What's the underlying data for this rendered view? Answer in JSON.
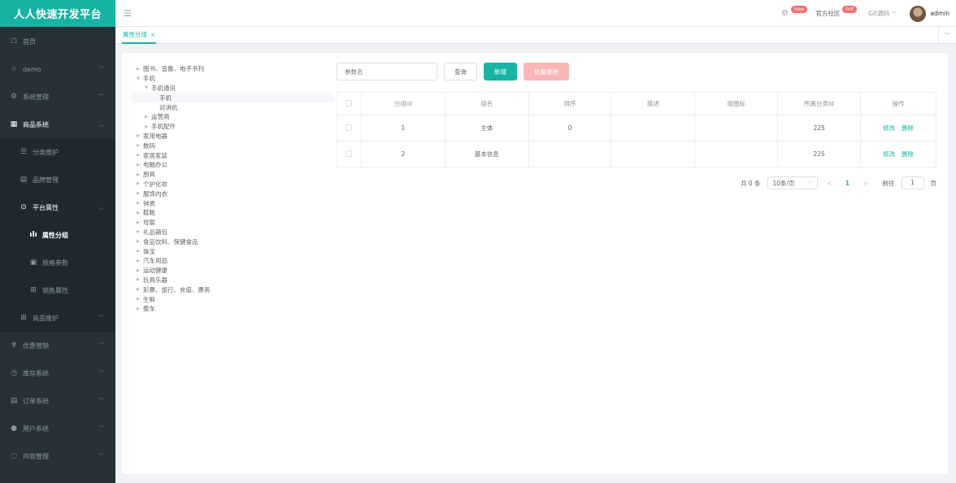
{
  "brand": "人人快速开发平台",
  "topbar": {
    "new_badge": "new",
    "community_label": "官方社区",
    "hot_badge": "hot",
    "git_label": "Git源码",
    "user_name": "admin"
  },
  "sidebar": {
    "items": [
      {
        "label": "首页",
        "icon": "☖"
      },
      {
        "label": "demo",
        "icon": "☆"
      },
      {
        "label": "系统管理",
        "icon": "⚙"
      },
      {
        "label": "商品系统",
        "icon": "▦"
      },
      {
        "label": "分类维护",
        "icon": "☰"
      },
      {
        "label": "品牌管理",
        "icon": "▤"
      },
      {
        "label": "平台属性",
        "icon": "⊙"
      },
      {
        "label": "属性分组",
        "icon": "ılı"
      },
      {
        "label": "规格参数",
        "icon": "▣"
      },
      {
        "label": "销售属性",
        "icon": "⊞"
      },
      {
        "label": "商品维护",
        "icon": "⊞"
      },
      {
        "label": "优惠营销",
        "icon": "♆"
      },
      {
        "label": "库存系统",
        "icon": "◷"
      },
      {
        "label": "订单系统",
        "icon": "▤"
      },
      {
        "label": "用户系统",
        "icon": "●"
      },
      {
        "label": "内容管理",
        "icon": "◌"
      }
    ]
  },
  "tabs": [
    {
      "label": "属性分组",
      "close": "×"
    }
  ],
  "tree": [
    {
      "label": "图书、音像、电子书刊",
      "caret": "▶"
    },
    {
      "label": "手机",
      "caret": "▼"
    },
    {
      "label": "手机通讯",
      "caret": "▼"
    },
    {
      "label": "手机",
      "caret": ""
    },
    {
      "label": "对讲机",
      "caret": ""
    },
    {
      "label": "运营商",
      "caret": "▶"
    },
    {
      "label": "手机配件",
      "caret": "▶"
    },
    {
      "label": "家用电器",
      "caret": "▶"
    },
    {
      "label": "数码",
      "caret": "▶"
    },
    {
      "label": "家居家装",
      "caret": "▶"
    },
    {
      "label": "电脑办公",
      "caret": "▶"
    },
    {
      "label": "厨具",
      "caret": "▶"
    },
    {
      "label": "个护化妆",
      "caret": "▶"
    },
    {
      "label": "服饰内衣",
      "caret": "▶"
    },
    {
      "label": "钟表",
      "caret": "▶"
    },
    {
      "label": "鞋靴",
      "caret": "▶"
    },
    {
      "label": "母婴",
      "caret": "▶"
    },
    {
      "label": "礼品箱包",
      "caret": "▶"
    },
    {
      "label": "食品饮料、保健食品",
      "caret": "▶"
    },
    {
      "label": "珠宝",
      "caret": "▶"
    },
    {
      "label": "汽车用品",
      "caret": "▶"
    },
    {
      "label": "运动健康",
      "caret": "▶"
    },
    {
      "label": "玩具乐器",
      "caret": "▶"
    },
    {
      "label": "彩票、旅行、充值、票务",
      "caret": "▶"
    },
    {
      "label": "生鲜",
      "caret": "▶"
    },
    {
      "label": "整车",
      "caret": "▶"
    }
  ],
  "toolbar": {
    "search_placeholder": "参数名",
    "query_label": "查询",
    "add_label": "新增",
    "batch_delete_label": "批量删除"
  },
  "table": {
    "headers": [
      "分组id",
      "组名",
      "排序",
      "描述",
      "组图标",
      "所属分类id",
      "操作"
    ],
    "rows": [
      {
        "id": "1",
        "name": "主体",
        "sort": "0",
        "desc": "",
        "icon": "",
        "catelog_id": "225",
        "edit": "修改",
        "delete": "删除"
      },
      {
        "id": "2",
        "name": "基本信息",
        "sort": "",
        "desc": "",
        "icon": "",
        "catelog_id": "225",
        "edit": "修改",
        "delete": "删除"
      }
    ]
  },
  "pagination": {
    "total_text": "共 0 条",
    "page_size": "10条/页",
    "prev": "<",
    "current": "1",
    "next": ">",
    "goto_label": "前往",
    "goto_value": "1",
    "page_suffix": "页"
  },
  "colors": {
    "accent": "#17b3a3",
    "sidebar_bg": "#263238",
    "danger_disabled": "#fab6b6"
  }
}
